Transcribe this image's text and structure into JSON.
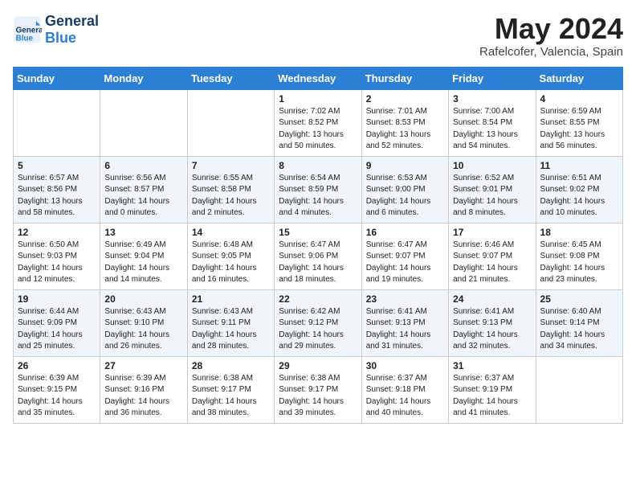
{
  "header": {
    "logo_general": "General",
    "logo_blue": "Blue",
    "month_title": "May 2024",
    "subtitle": "Rafelcofer, Valencia, Spain"
  },
  "weekdays": [
    "Sunday",
    "Monday",
    "Tuesday",
    "Wednesday",
    "Thursday",
    "Friday",
    "Saturday"
  ],
  "weeks": [
    [
      null,
      null,
      null,
      {
        "day": 1,
        "sunrise": "7:02 AM",
        "sunset": "8:52 PM",
        "daylight": "13 hours and 50 minutes."
      },
      {
        "day": 2,
        "sunrise": "7:01 AM",
        "sunset": "8:53 PM",
        "daylight": "13 hours and 52 minutes."
      },
      {
        "day": 3,
        "sunrise": "7:00 AM",
        "sunset": "8:54 PM",
        "daylight": "13 hours and 54 minutes."
      },
      {
        "day": 4,
        "sunrise": "6:59 AM",
        "sunset": "8:55 PM",
        "daylight": "13 hours and 56 minutes."
      }
    ],
    [
      {
        "day": 5,
        "sunrise": "6:57 AM",
        "sunset": "8:56 PM",
        "daylight": "13 hours and 58 minutes."
      },
      {
        "day": 6,
        "sunrise": "6:56 AM",
        "sunset": "8:57 PM",
        "daylight": "14 hours and 0 minutes."
      },
      {
        "day": 7,
        "sunrise": "6:55 AM",
        "sunset": "8:58 PM",
        "daylight": "14 hours and 2 minutes."
      },
      {
        "day": 8,
        "sunrise": "6:54 AM",
        "sunset": "8:59 PM",
        "daylight": "14 hours and 4 minutes."
      },
      {
        "day": 9,
        "sunrise": "6:53 AM",
        "sunset": "9:00 PM",
        "daylight": "14 hours and 6 minutes."
      },
      {
        "day": 10,
        "sunrise": "6:52 AM",
        "sunset": "9:01 PM",
        "daylight": "14 hours and 8 minutes."
      },
      {
        "day": 11,
        "sunrise": "6:51 AM",
        "sunset": "9:02 PM",
        "daylight": "14 hours and 10 minutes."
      }
    ],
    [
      {
        "day": 12,
        "sunrise": "6:50 AM",
        "sunset": "9:03 PM",
        "daylight": "14 hours and 12 minutes."
      },
      {
        "day": 13,
        "sunrise": "6:49 AM",
        "sunset": "9:04 PM",
        "daylight": "14 hours and 14 minutes."
      },
      {
        "day": 14,
        "sunrise": "6:48 AM",
        "sunset": "9:05 PM",
        "daylight": "14 hours and 16 minutes."
      },
      {
        "day": 15,
        "sunrise": "6:47 AM",
        "sunset": "9:06 PM",
        "daylight": "14 hours and 18 minutes."
      },
      {
        "day": 16,
        "sunrise": "6:47 AM",
        "sunset": "9:07 PM",
        "daylight": "14 hours and 19 minutes."
      },
      {
        "day": 17,
        "sunrise": "6:46 AM",
        "sunset": "9:07 PM",
        "daylight": "14 hours and 21 minutes."
      },
      {
        "day": 18,
        "sunrise": "6:45 AM",
        "sunset": "9:08 PM",
        "daylight": "14 hours and 23 minutes."
      }
    ],
    [
      {
        "day": 19,
        "sunrise": "6:44 AM",
        "sunset": "9:09 PM",
        "daylight": "14 hours and 25 minutes."
      },
      {
        "day": 20,
        "sunrise": "6:43 AM",
        "sunset": "9:10 PM",
        "daylight": "14 hours and 26 minutes."
      },
      {
        "day": 21,
        "sunrise": "6:43 AM",
        "sunset": "9:11 PM",
        "daylight": "14 hours and 28 minutes."
      },
      {
        "day": 22,
        "sunrise": "6:42 AM",
        "sunset": "9:12 PM",
        "daylight": "14 hours and 29 minutes."
      },
      {
        "day": 23,
        "sunrise": "6:41 AM",
        "sunset": "9:13 PM",
        "daylight": "14 hours and 31 minutes."
      },
      {
        "day": 24,
        "sunrise": "6:41 AM",
        "sunset": "9:13 PM",
        "daylight": "14 hours and 32 minutes."
      },
      {
        "day": 25,
        "sunrise": "6:40 AM",
        "sunset": "9:14 PM",
        "daylight": "14 hours and 34 minutes."
      }
    ],
    [
      {
        "day": 26,
        "sunrise": "6:39 AM",
        "sunset": "9:15 PM",
        "daylight": "14 hours and 35 minutes."
      },
      {
        "day": 27,
        "sunrise": "6:39 AM",
        "sunset": "9:16 PM",
        "daylight": "14 hours and 36 minutes."
      },
      {
        "day": 28,
        "sunrise": "6:38 AM",
        "sunset": "9:17 PM",
        "daylight": "14 hours and 38 minutes."
      },
      {
        "day": 29,
        "sunrise": "6:38 AM",
        "sunset": "9:17 PM",
        "daylight": "14 hours and 39 minutes."
      },
      {
        "day": 30,
        "sunrise": "6:37 AM",
        "sunset": "9:18 PM",
        "daylight": "14 hours and 40 minutes."
      },
      {
        "day": 31,
        "sunrise": "6:37 AM",
        "sunset": "9:19 PM",
        "daylight": "14 hours and 41 minutes."
      },
      null
    ]
  ]
}
